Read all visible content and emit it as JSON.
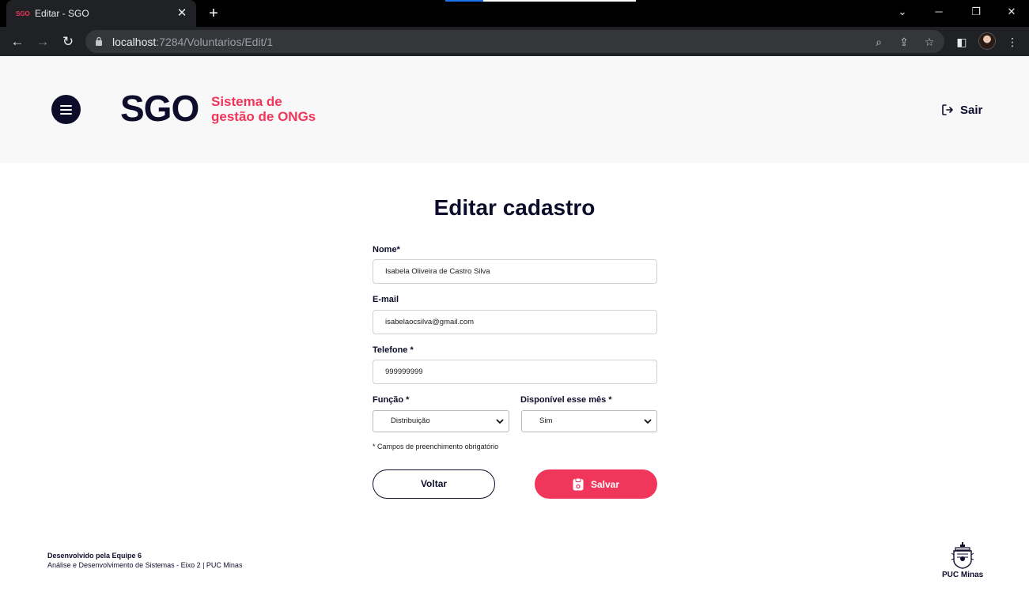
{
  "browser": {
    "tab_title": "Editar - SGO",
    "tab_favicon_text": "SGO",
    "url_host": "localhost",
    "url_path": ":7284/Voluntarios/Edit/1"
  },
  "header": {
    "logo": "SGO",
    "subtitle_line1": "Sistema de",
    "subtitle_line2": "gestão de ONGs",
    "logout_label": "Sair"
  },
  "form": {
    "title": "Editar cadastro",
    "nome": {
      "label": "Nome*",
      "value": "Isabela Oliveira de Castro Silva"
    },
    "email": {
      "label": "E-mail",
      "value": "isabelaocsilva@gmail.com"
    },
    "telefone": {
      "label": "Telefone *",
      "value": "999999999"
    },
    "funcao": {
      "label": "Função *",
      "selected": "Distribuição"
    },
    "disponivel": {
      "label": "Disponível esse mês *",
      "selected": "Sim"
    },
    "hint": "* Campos de preenchimento obrigatório",
    "back_label": "Voltar",
    "save_label": "Salvar"
  },
  "footer": {
    "line1": "Desenvolvido pela Equipe 6",
    "line2": "Análise e Desenvolvimento de Sistemas - Eixo 2 | PUC Minas",
    "puc_label": "PUC Minas"
  },
  "colors": {
    "brand_pink": "#f0365a",
    "brand_navy": "#0d0d2b",
    "header_bg": "#f8f8f8"
  }
}
